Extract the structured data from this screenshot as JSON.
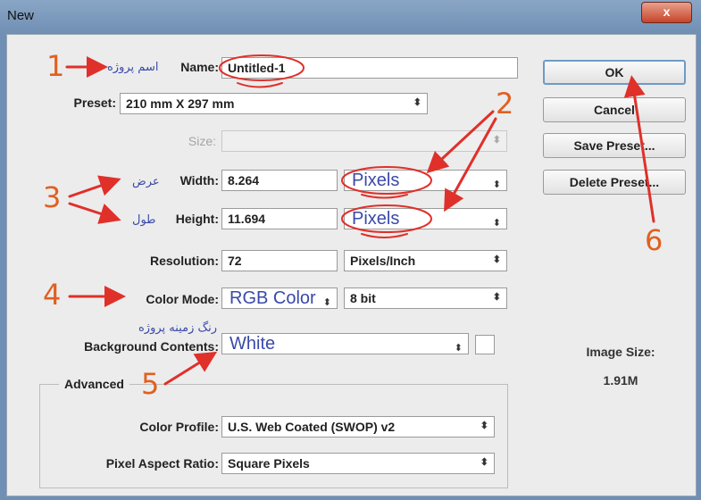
{
  "window": {
    "title": "New",
    "close_label": "x"
  },
  "fields": {
    "name": {
      "label": "Name:",
      "value": "Untitled-1"
    },
    "preset": {
      "label": "Preset:",
      "value": "210 mm X 297 mm"
    },
    "size": {
      "label": "Size:",
      "value": ""
    },
    "width": {
      "label": "Width:",
      "value": "8.264",
      "unit": "Pixels"
    },
    "height": {
      "label": "Height:",
      "value": "11.694",
      "unit": "Pixels"
    },
    "resolution": {
      "label": "Resolution:",
      "value": "72",
      "unit": "Pixels/Inch"
    },
    "color_mode": {
      "label": "Color Mode:",
      "value": "RGB Color",
      "depth": "8 bit"
    },
    "background": {
      "label": "Background Contents:",
      "value": "White"
    }
  },
  "advanced": {
    "legend": "Advanced",
    "color_profile": {
      "label": "Color Profile:",
      "value": "U.S. Web Coated (SWOP) v2"
    },
    "pixel_aspect_ratio": {
      "label": "Pixel Aspect Ratio:",
      "value": "Square Pixels"
    }
  },
  "buttons": {
    "ok": "OK",
    "cancel": "Cancel",
    "save_preset": "Save Preset...",
    "delete_preset": "Delete Preset..."
  },
  "image_size": {
    "label": "Image Size:",
    "value": "1.91M"
  },
  "annotations": {
    "persian_name": "اسم پروژه",
    "persian_width": "عرض",
    "persian_height": "طول",
    "persian_background": "رنگ زمینه پروژه",
    "numbers": [
      "1",
      "2",
      "3",
      "4",
      "5",
      "6"
    ]
  },
  "colors": {
    "annotation_red": "#e0302a",
    "annotation_orange": "#e06020",
    "field_blue_text": "#3a49a8"
  }
}
